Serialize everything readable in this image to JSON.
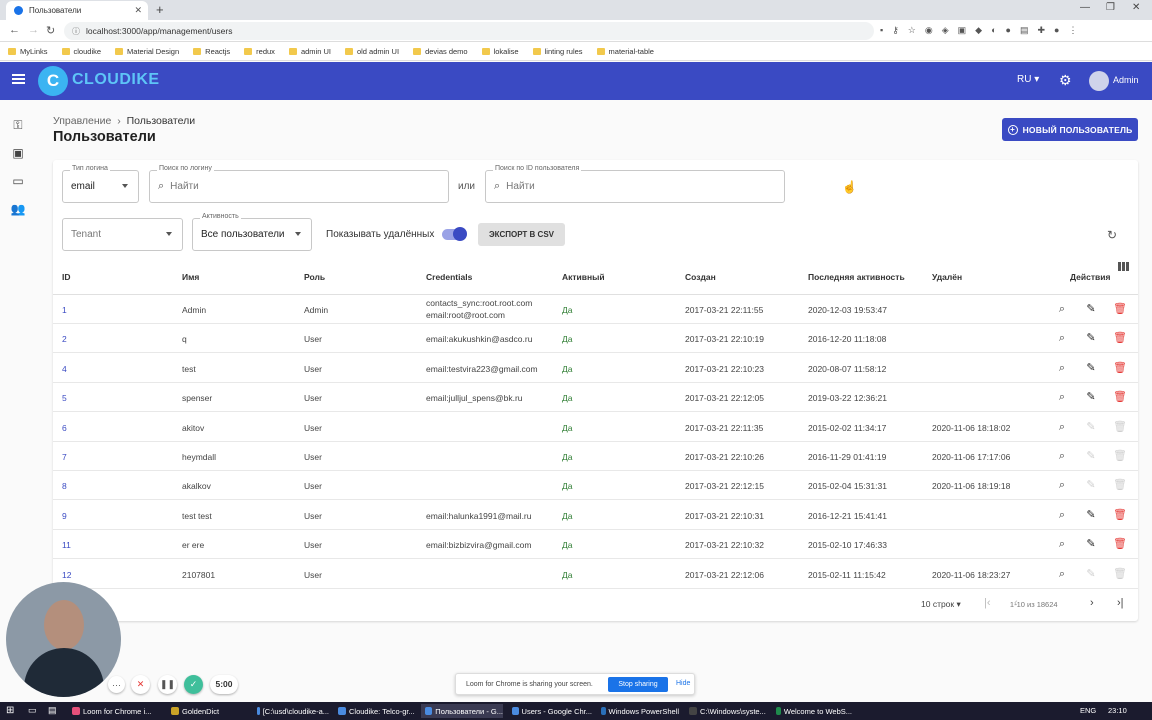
{
  "browser": {
    "tab_title": "Пользователи",
    "url": "localhost:3000/app/management/users",
    "bookmarks": [
      "MyLinks",
      "cloudike",
      "Material Design",
      "Reactjs",
      "redux",
      "admin UI",
      "old admin UI",
      "devias demo",
      "lokalise",
      "linting rules",
      "material-table"
    ]
  },
  "app": {
    "brand": "CLOUDIKE",
    "lang": "RU",
    "user": "Admin"
  },
  "page": {
    "breadcrumb_root": "Управление",
    "breadcrumb_current": "Пользователи",
    "title": "Пользователи",
    "new_user_label": "НОВЫЙ ПОЛЬЗОВАТЕЛЬ"
  },
  "filters": {
    "login_type_label": "Тип логина",
    "login_type_value": "email",
    "login_search_label": "Поиск по логину",
    "login_search_placeholder": "Найти",
    "or_text": "или",
    "id_search_label": "Поиск по ID пользователя",
    "id_search_placeholder": "Найти",
    "tenant_placeholder": "Tenant",
    "activity_label": "Активность",
    "activity_value": "Все пользователи",
    "show_deleted_label": "Показывать удалённых",
    "show_deleted_on": true,
    "export_label": "ЭКСПОРТ В CSV"
  },
  "table": {
    "headers": [
      "ID",
      "Имя",
      "Роль",
      "Credentials",
      "Активный",
      "Создан",
      "Последняя активность",
      "Удалён",
      "Действия"
    ],
    "rows": [
      {
        "id": "1",
        "name": "Admin",
        "role": "Admin",
        "cred1": "contacts_sync:root.root.com",
        "cred2": "email:root@root.com",
        "active": "Да",
        "created": "2017-03-21  22:11:55",
        "last": "2020-12-03  19:53:47",
        "deleted": "",
        "editable": true
      },
      {
        "id": "2",
        "name": "q",
        "role": "User",
        "cred1": "email:akukushkin@asdco.ru",
        "cred2": "",
        "active": "Да",
        "created": "2017-03-21  22:10:19",
        "last": "2016-12-20  11:18:08",
        "deleted": "",
        "editable": true
      },
      {
        "id": "4",
        "name": "test",
        "role": "User",
        "cred1": "email:testvira223@gmail.com",
        "cred2": "",
        "active": "Да",
        "created": "2017-03-21  22:10:23",
        "last": "2020-08-07  11:58:12",
        "deleted": "",
        "editable": true
      },
      {
        "id": "5",
        "name": "spenser",
        "role": "User",
        "cred1": "email:julljul_spens@bk.ru",
        "cred2": "",
        "active": "Да",
        "created": "2017-03-21  22:12:05",
        "last": "2019-03-22  12:36:21",
        "deleted": "",
        "editable": true
      },
      {
        "id": "6",
        "name": "akitov",
        "role": "User",
        "cred1": "",
        "cred2": "",
        "active": "Да",
        "created": "2017-03-21  22:11:35",
        "last": "2015-02-02  11:34:17",
        "deleted": "2020-11-06  18:18:02",
        "editable": false
      },
      {
        "id": "7",
        "name": "heymdall",
        "role": "User",
        "cred1": "",
        "cred2": "",
        "active": "Да",
        "created": "2017-03-21  22:10:26",
        "last": "2016-11-29  01:41:19",
        "deleted": "2020-11-06  17:17:06",
        "editable": false
      },
      {
        "id": "8",
        "name": "akalkov",
        "role": "User",
        "cred1": "",
        "cred2": "",
        "active": "Да",
        "created": "2017-03-21  22:12:15",
        "last": "2015-02-04  15:31:31",
        "deleted": "2020-11-06  18:19:18",
        "editable": false
      },
      {
        "id": "9",
        "name": "test test",
        "role": "User",
        "cred1": "email:halunka1991@mail.ru",
        "cred2": "",
        "active": "Да",
        "created": "2017-03-21  22:10:31",
        "last": "2016-12-21  15:41:41",
        "deleted": "",
        "editable": true
      },
      {
        "id": "11",
        "name": "er ere",
        "role": "User",
        "cred1": "email:bizbizvira@gmail.com",
        "cred2": "",
        "active": "Да",
        "created": "2017-03-21  22:10:32",
        "last": "2015-02-10  17:46:33",
        "deleted": "",
        "editable": true
      },
      {
        "id": "12",
        "name": "2107801",
        "role": "User",
        "cred1": "",
        "cred2": "",
        "active": "Да",
        "created": "2017-03-21  22:12:06",
        "last": "2015-02-11  11:15:42",
        "deleted": "2020-11-06  18:23:27",
        "editable": false
      }
    ]
  },
  "pagination": {
    "rows_per_page": "10 строк",
    "range": "1-10 из 18624"
  },
  "loom": {
    "timer": "5:00",
    "share_message": "Loom for Chrome is sharing your screen.",
    "stop_label": "Stop sharing",
    "hide_label": "Hide"
  },
  "taskbar": {
    "items": [
      "Loom for Chrome i...",
      "GoldenDict",
      "[C:\\usd\\cloudike-a...",
      "Cloudike: Telco-gr...",
      "Пользователи - G...",
      "Users - Google Chr...",
      "Windows PowerShell",
      "C:\\Windows\\syste...",
      "Welcome to WebS..."
    ],
    "lang": "ENG",
    "time": "23:10"
  }
}
